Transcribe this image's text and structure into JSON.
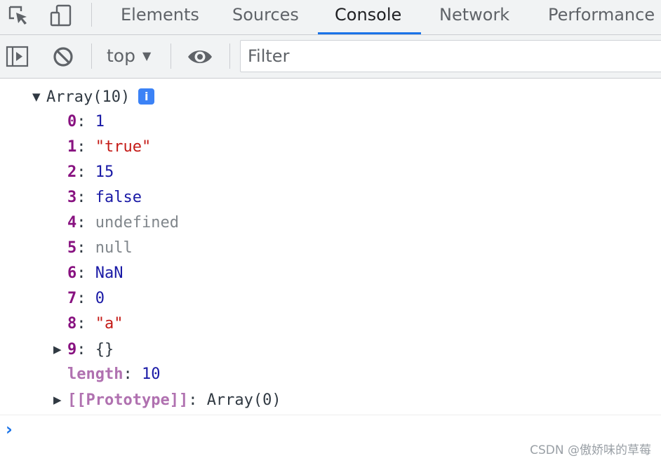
{
  "tabs": [
    {
      "label": "Elements",
      "active": false
    },
    {
      "label": "Sources",
      "active": false
    },
    {
      "label": "Console",
      "active": true
    },
    {
      "label": "Network",
      "active": false
    },
    {
      "label": "Performance",
      "active": false
    }
  ],
  "icons": {
    "inspect": "inspect-element-icon",
    "device": "device-toolbar-icon",
    "sidebar": "show-sidebar-icon",
    "clear": "clear-console-icon",
    "live": "live-expression-eye-icon",
    "dropdown": "dropdown-arrow-icon"
  },
  "toolbar": {
    "context": "top",
    "context_arrow": "▼",
    "filter_placeholder": "Filter",
    "filter_value": ""
  },
  "console": {
    "header": "Array(10)",
    "info_badge": "i",
    "items": [
      {
        "key": "0",
        "value": "1",
        "kind": "number"
      },
      {
        "key": "1",
        "value": "\"true\"",
        "kind": "string"
      },
      {
        "key": "2",
        "value": "15",
        "kind": "number"
      },
      {
        "key": "3",
        "value": "false",
        "kind": "bool"
      },
      {
        "key": "4",
        "value": "undefined",
        "kind": "undef"
      },
      {
        "key": "5",
        "value": "null",
        "kind": "null"
      },
      {
        "key": "6",
        "value": "NaN",
        "kind": "number"
      },
      {
        "key": "7",
        "value": "0",
        "kind": "number"
      },
      {
        "key": "8",
        "value": "\"a\"",
        "kind": "string"
      },
      {
        "key": "9",
        "value": "{}",
        "kind": "object"
      }
    ],
    "length_key": "length",
    "length_value": "10",
    "proto_key": "[[Prototype]]",
    "proto_value": "Array(0)",
    "prompt": "›"
  },
  "watermark": "CSDN @傲娇味的草莓",
  "colors": {
    "accent": "#1a73e8",
    "key": "#881280",
    "string": "#c41a16",
    "number": "#1a1aa6",
    "muted": "#80868b"
  }
}
